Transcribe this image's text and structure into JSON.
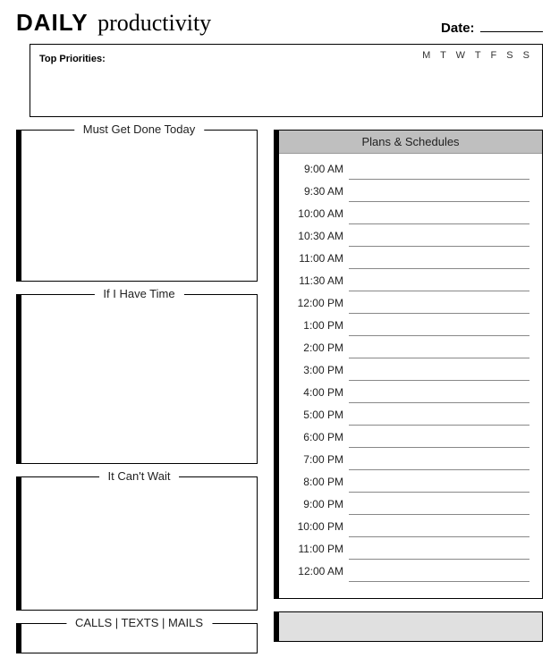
{
  "header": {
    "title_bold": "DAILY",
    "title_script": "productivity",
    "date_label": "Date:"
  },
  "priorities": {
    "label": "Top Priorities:",
    "weekdays": "M T W T F S S"
  },
  "left_boxes": {
    "must": "Must Get Done Today",
    "if_time": "If I Have Time",
    "cant_wait": "It Can't Wait",
    "calls": "CALLS | TEXTS | MAILS"
  },
  "right": {
    "plans_header": "Plans & Schedules",
    "slots": [
      "9:00 AM",
      "9:30 AM",
      "10:00 AM",
      "10:30 AM",
      "11:00 AM",
      "11:30 AM",
      "12:00 PM",
      "1:00 PM",
      "2:00 PM",
      "3:00 PM",
      "4:00 PM",
      "5:00 PM",
      "6:00 PM",
      "7:00 PM",
      "8:00 PM",
      "9:00 PM",
      "10:00 PM",
      "11:00 PM",
      "12:00 AM"
    ]
  }
}
